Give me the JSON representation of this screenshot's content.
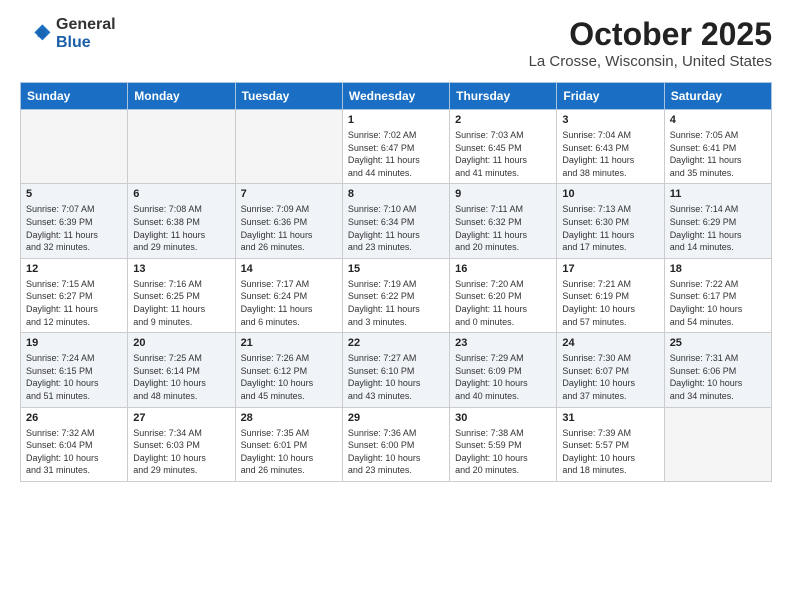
{
  "header": {
    "logo_general": "General",
    "logo_blue": "Blue",
    "month_title": "October 2025",
    "location": "La Crosse, Wisconsin, United States"
  },
  "weekdays": [
    "Sunday",
    "Monday",
    "Tuesday",
    "Wednesday",
    "Thursday",
    "Friday",
    "Saturday"
  ],
  "weeks": [
    {
      "shaded": false,
      "days": [
        {
          "date": "",
          "info": ""
        },
        {
          "date": "",
          "info": ""
        },
        {
          "date": "",
          "info": ""
        },
        {
          "date": "1",
          "info": "Sunrise: 7:02 AM\nSunset: 6:47 PM\nDaylight: 11 hours\nand 44 minutes."
        },
        {
          "date": "2",
          "info": "Sunrise: 7:03 AM\nSunset: 6:45 PM\nDaylight: 11 hours\nand 41 minutes."
        },
        {
          "date": "3",
          "info": "Sunrise: 7:04 AM\nSunset: 6:43 PM\nDaylight: 11 hours\nand 38 minutes."
        },
        {
          "date": "4",
          "info": "Sunrise: 7:05 AM\nSunset: 6:41 PM\nDaylight: 11 hours\nand 35 minutes."
        }
      ]
    },
    {
      "shaded": true,
      "days": [
        {
          "date": "5",
          "info": "Sunrise: 7:07 AM\nSunset: 6:39 PM\nDaylight: 11 hours\nand 32 minutes."
        },
        {
          "date": "6",
          "info": "Sunrise: 7:08 AM\nSunset: 6:38 PM\nDaylight: 11 hours\nand 29 minutes."
        },
        {
          "date": "7",
          "info": "Sunrise: 7:09 AM\nSunset: 6:36 PM\nDaylight: 11 hours\nand 26 minutes."
        },
        {
          "date": "8",
          "info": "Sunrise: 7:10 AM\nSunset: 6:34 PM\nDaylight: 11 hours\nand 23 minutes."
        },
        {
          "date": "9",
          "info": "Sunrise: 7:11 AM\nSunset: 6:32 PM\nDaylight: 11 hours\nand 20 minutes."
        },
        {
          "date": "10",
          "info": "Sunrise: 7:13 AM\nSunset: 6:30 PM\nDaylight: 11 hours\nand 17 minutes."
        },
        {
          "date": "11",
          "info": "Sunrise: 7:14 AM\nSunset: 6:29 PM\nDaylight: 11 hours\nand 14 minutes."
        }
      ]
    },
    {
      "shaded": false,
      "days": [
        {
          "date": "12",
          "info": "Sunrise: 7:15 AM\nSunset: 6:27 PM\nDaylight: 11 hours\nand 12 minutes."
        },
        {
          "date": "13",
          "info": "Sunrise: 7:16 AM\nSunset: 6:25 PM\nDaylight: 11 hours\nand 9 minutes."
        },
        {
          "date": "14",
          "info": "Sunrise: 7:17 AM\nSunset: 6:24 PM\nDaylight: 11 hours\nand 6 minutes."
        },
        {
          "date": "15",
          "info": "Sunrise: 7:19 AM\nSunset: 6:22 PM\nDaylight: 11 hours\nand 3 minutes."
        },
        {
          "date": "16",
          "info": "Sunrise: 7:20 AM\nSunset: 6:20 PM\nDaylight: 11 hours\nand 0 minutes."
        },
        {
          "date": "17",
          "info": "Sunrise: 7:21 AM\nSunset: 6:19 PM\nDaylight: 10 hours\nand 57 minutes."
        },
        {
          "date": "18",
          "info": "Sunrise: 7:22 AM\nSunset: 6:17 PM\nDaylight: 10 hours\nand 54 minutes."
        }
      ]
    },
    {
      "shaded": true,
      "days": [
        {
          "date": "19",
          "info": "Sunrise: 7:24 AM\nSunset: 6:15 PM\nDaylight: 10 hours\nand 51 minutes."
        },
        {
          "date": "20",
          "info": "Sunrise: 7:25 AM\nSunset: 6:14 PM\nDaylight: 10 hours\nand 48 minutes."
        },
        {
          "date": "21",
          "info": "Sunrise: 7:26 AM\nSunset: 6:12 PM\nDaylight: 10 hours\nand 45 minutes."
        },
        {
          "date": "22",
          "info": "Sunrise: 7:27 AM\nSunset: 6:10 PM\nDaylight: 10 hours\nand 43 minutes."
        },
        {
          "date": "23",
          "info": "Sunrise: 7:29 AM\nSunset: 6:09 PM\nDaylight: 10 hours\nand 40 minutes."
        },
        {
          "date": "24",
          "info": "Sunrise: 7:30 AM\nSunset: 6:07 PM\nDaylight: 10 hours\nand 37 minutes."
        },
        {
          "date": "25",
          "info": "Sunrise: 7:31 AM\nSunset: 6:06 PM\nDaylight: 10 hours\nand 34 minutes."
        }
      ]
    },
    {
      "shaded": false,
      "days": [
        {
          "date": "26",
          "info": "Sunrise: 7:32 AM\nSunset: 6:04 PM\nDaylight: 10 hours\nand 31 minutes."
        },
        {
          "date": "27",
          "info": "Sunrise: 7:34 AM\nSunset: 6:03 PM\nDaylight: 10 hours\nand 29 minutes."
        },
        {
          "date": "28",
          "info": "Sunrise: 7:35 AM\nSunset: 6:01 PM\nDaylight: 10 hours\nand 26 minutes."
        },
        {
          "date": "29",
          "info": "Sunrise: 7:36 AM\nSunset: 6:00 PM\nDaylight: 10 hours\nand 23 minutes."
        },
        {
          "date": "30",
          "info": "Sunrise: 7:38 AM\nSunset: 5:59 PM\nDaylight: 10 hours\nand 20 minutes."
        },
        {
          "date": "31",
          "info": "Sunrise: 7:39 AM\nSunset: 5:57 PM\nDaylight: 10 hours\nand 18 minutes."
        },
        {
          "date": "",
          "info": ""
        }
      ]
    }
  ]
}
